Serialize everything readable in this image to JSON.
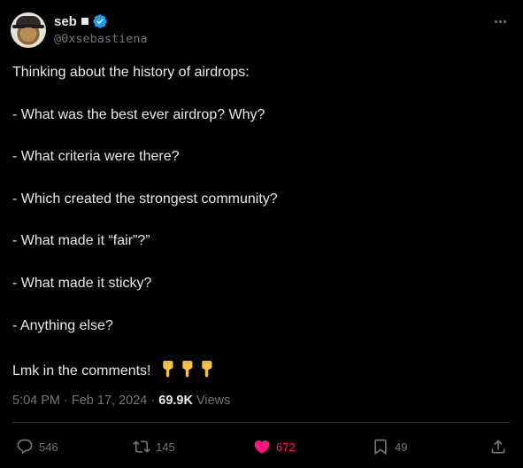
{
  "author": {
    "display_name": "seb",
    "handle": "@0xsebastiena"
  },
  "tweet": {
    "lines": [
      "Thinking about the history of airdrops:",
      "- What was the best ever airdrop? Why?",
      "- What criteria were there?",
      "- Which created the strongest community?",
      "- What made it “fair”?”",
      "- What made it sticky?",
      "- Anything else?",
      "Lmk in the comments!"
    ],
    "emoji": [
      "pointing-down-hand",
      "pointing-down-hand",
      "pointing-down-hand"
    ]
  },
  "meta": {
    "time": "5:04 PM",
    "sep1": " · ",
    "date": "Feb 17, 2024",
    "sep2": " · ",
    "views_count": "69.9K",
    "views_label": " Views"
  },
  "actions": {
    "replies": "546",
    "reposts": "145",
    "likes": "672",
    "bookmarks": "49"
  },
  "colors": {
    "background": "#000000",
    "text": "#e7e9ea",
    "muted": "#71767b",
    "verified": "#1d9bf0",
    "like": "#f91880"
  }
}
